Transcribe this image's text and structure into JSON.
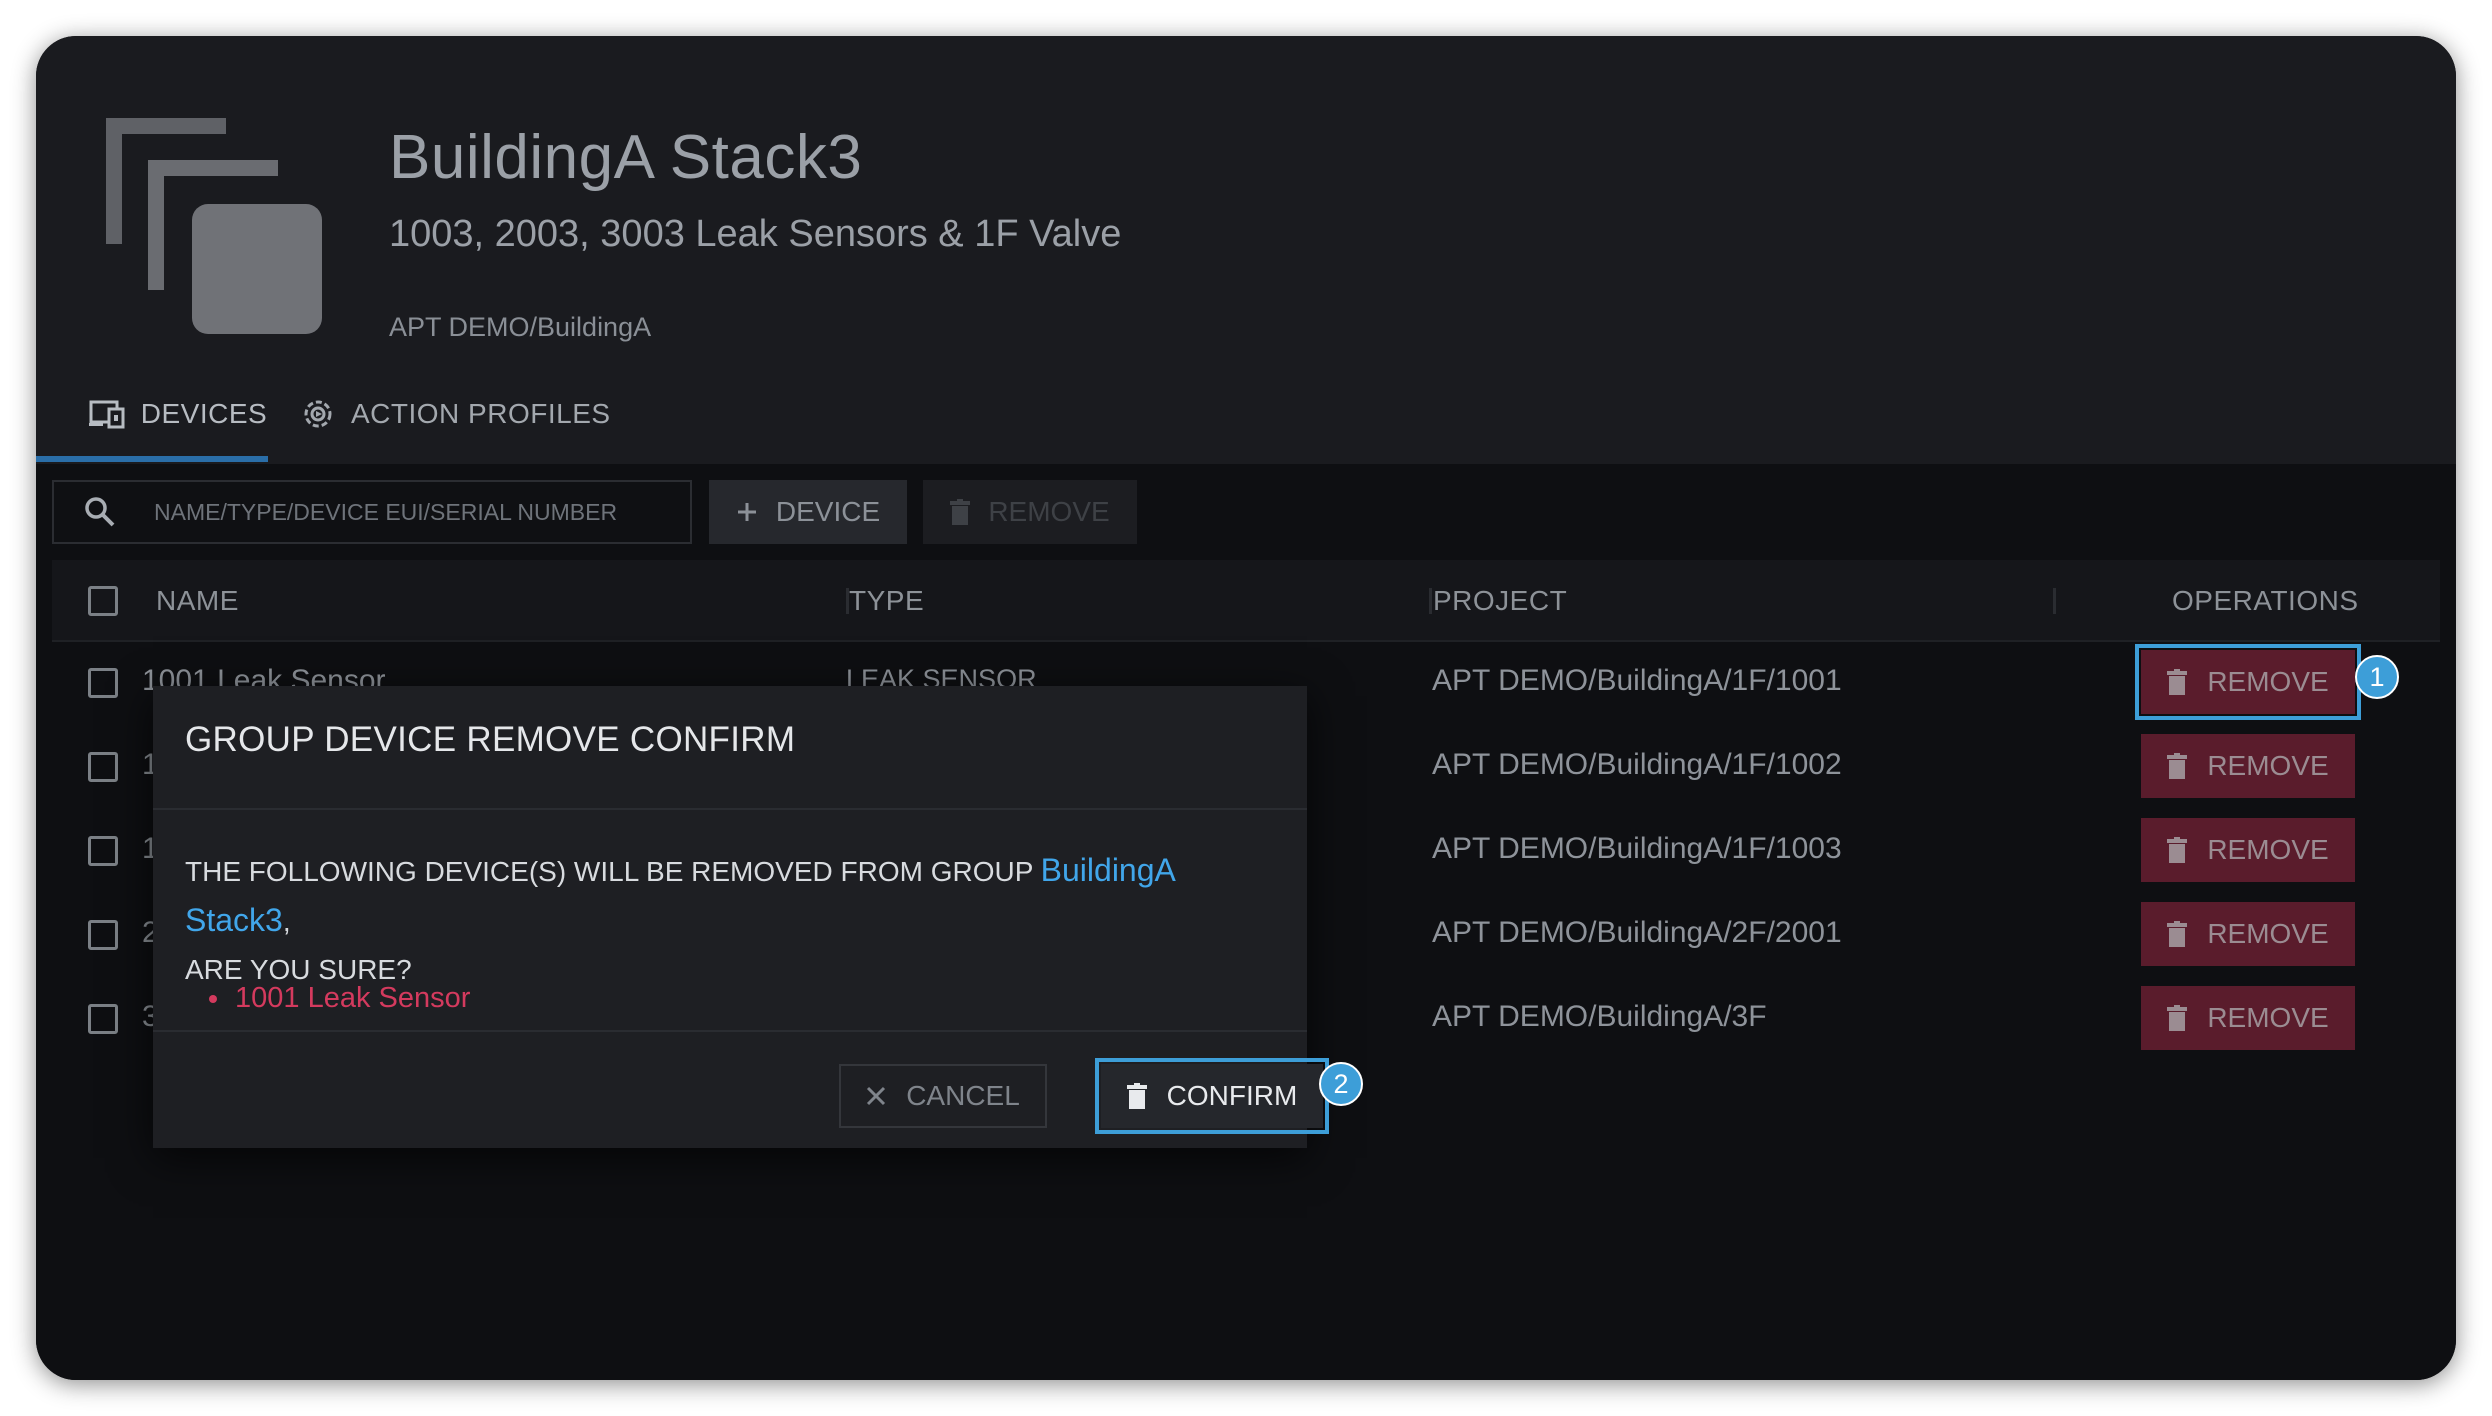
{
  "group": {
    "title": "BuildingA Stack3",
    "subtitle": "1003, 2003, 3003 Leak Sensors & 1F Valve",
    "path": "APT DEMO/BuildingA"
  },
  "tabs": [
    {
      "label": "DEVICES",
      "icon": "devices-icon",
      "active": true
    },
    {
      "label": "ACTION PROFILES",
      "icon": "action-profile-icon",
      "active": false
    }
  ],
  "toolbar": {
    "search_placeholder": "NAME/TYPE/DEVICE EUI/SERIAL NUMBER",
    "add_device_label": "DEVICE",
    "remove_label": "REMOVE"
  },
  "table": {
    "columns": [
      "NAME",
      "TYPE",
      "PROJECT",
      "OPERATIONS"
    ],
    "rows": [
      {
        "name": "1001 Leak Sensor",
        "type": "LEAK SENSOR",
        "project": "APT DEMO/BuildingA/1F/1001",
        "action": "REMOVE"
      },
      {
        "name": "1",
        "type": "",
        "project": "APT DEMO/BuildingA/1F/1002",
        "action": "REMOVE"
      },
      {
        "name": "1",
        "type": "",
        "project": "APT DEMO/BuildingA/1F/1003",
        "action": "REMOVE"
      },
      {
        "name": "2",
        "type": "",
        "project": "APT DEMO/BuildingA/2F/2001",
        "action": "REMOVE"
      },
      {
        "name": "3",
        "type": "",
        "project": "APT DEMO/BuildingA/3F",
        "action": "REMOVE"
      }
    ]
  },
  "dialog": {
    "title": "GROUP DEVICE REMOVE CONFIRM",
    "message_prefix": "THE FOLLOWING DEVICE(S) WILL BE REMOVED FROM GROUP ",
    "group_name": "BuildingA Stack3",
    "message_suffix": ",",
    "question": "ARE YOU SURE?",
    "devices": [
      "1001 Leak Sensor"
    ],
    "cancel_label": "CANCEL",
    "confirm_label": "CONFIRM"
  },
  "annotations": {
    "step1": "1",
    "step2": "2"
  },
  "colors": {
    "accent": "#3d9ed8",
    "danger": "#5a1c2c",
    "danger_text": "#d43a5e",
    "link": "#41a6ea"
  }
}
